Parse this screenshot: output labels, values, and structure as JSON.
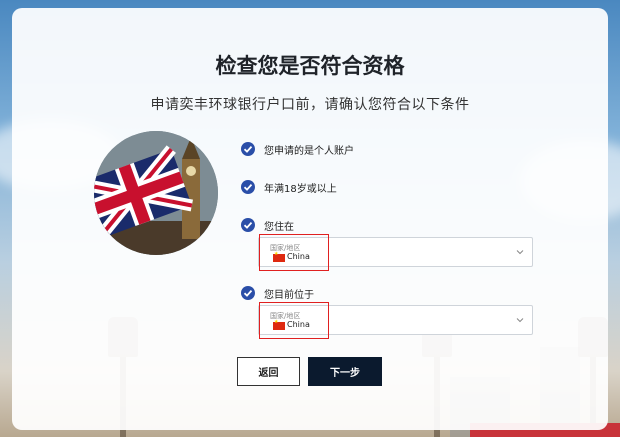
{
  "page": {
    "title": "检查您是否符合资格",
    "subtitle": "申请奕丰环球银行户口前，请确认您符合以下条件"
  },
  "checklist": [
    {
      "label": "您申请的是个人账户"
    },
    {
      "label": "年满18岁或以上"
    },
    {
      "label": "您住在"
    },
    {
      "label": "您目前位于"
    }
  ],
  "residence_select": {
    "caption": "国家/地区",
    "value": "China"
  },
  "location_select": {
    "caption": "国家/地区",
    "value": "China"
  },
  "buttons": {
    "back": "返回",
    "next": "下一步"
  },
  "colors": {
    "check": "#2a4ea8",
    "next_button": "#0b1a2e",
    "highlight": "#e02020"
  }
}
